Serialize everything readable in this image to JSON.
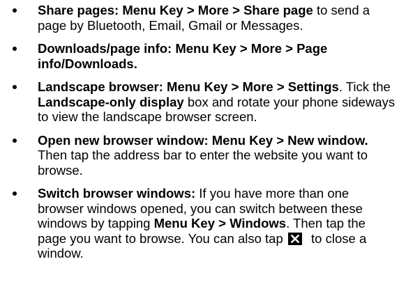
{
  "items": [
    {
      "bold": "Share pages: Menu Key > More > Share page",
      "text": " to send a page by Bluetooth, Email, Gmail or Messages."
    },
    {
      "bold": "Downloads/page info: Menu Key > More > Page info/Downloads."
    },
    {
      "bold": "Landscape browser: Menu Key > More > Settings",
      "text1": ". Tick the ",
      "bold2": "Landscape-only display",
      "text2": " box and rotate your phone sideways to view the landscape browser screen."
    },
    {
      "bold": "Open new browser window: Menu Key > New window.",
      "text": " Then tap the address bar to enter the website you want to browse."
    },
    {
      "bold": "Switch browser windows:",
      "text1": " If you have more than one browser windows opened, you can switch between these windows by tapping ",
      "bold2": "Menu Key > Windows",
      "text2": ". Then tap the page you want to browse. You can also tap ",
      "text3": " to close a window."
    }
  ],
  "icons": {
    "close": "close-icon"
  }
}
